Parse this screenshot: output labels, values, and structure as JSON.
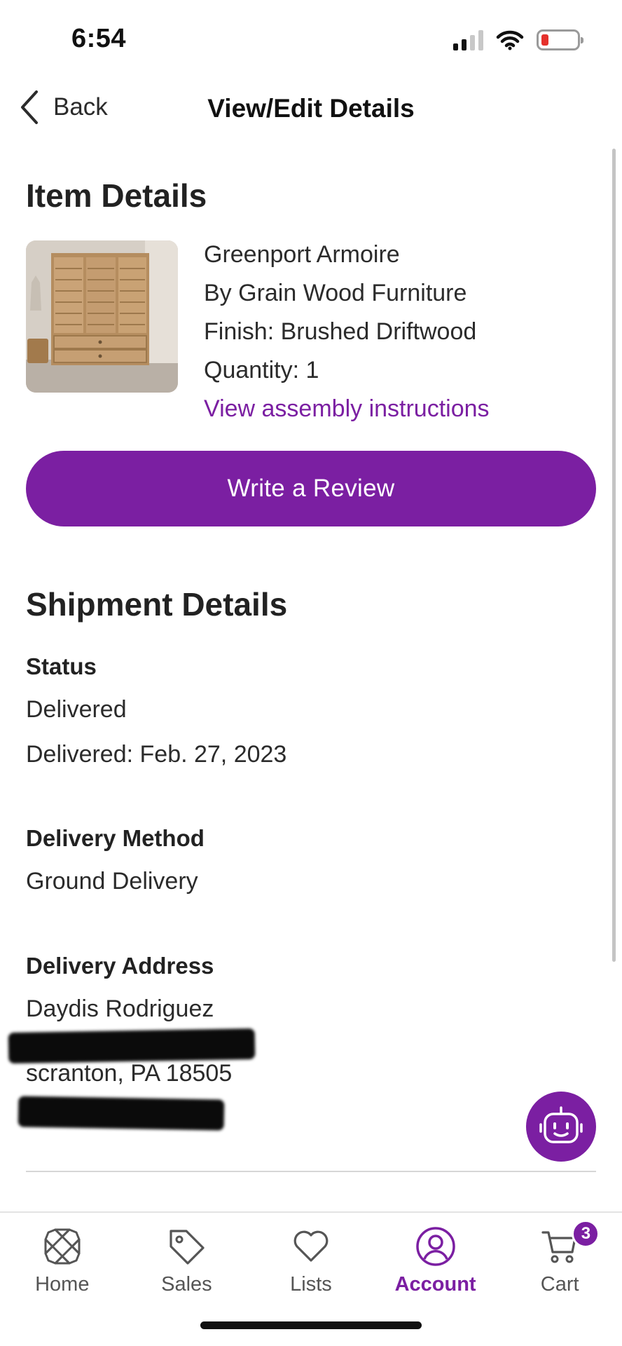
{
  "status_bar": {
    "time": "6:54"
  },
  "header": {
    "back_label": "Back",
    "title": "View/Edit Details"
  },
  "item_details": {
    "section_title": "Item Details",
    "product_name": "Greenport Armoire",
    "brand": "By Grain Wood Furniture",
    "finish": "Finish: Brushed Driftwood",
    "quantity": "Quantity: 1",
    "assembly_link": "View assembly instructions",
    "review_button": "Write a Review"
  },
  "shipment_details": {
    "section_title": "Shipment Details",
    "status_label": "Status",
    "status_value": "Delivered",
    "delivered_date": "Delivered: Feb. 27, 2023",
    "method_label": "Delivery Method",
    "method_value": "Ground Delivery",
    "address_label": "Delivery Address",
    "address_name": "Daydis Rodriguez",
    "address_city": "scranton, PA 18505"
  },
  "tab_bar": {
    "tabs": [
      {
        "label": "Home",
        "icon": "home-icon"
      },
      {
        "label": "Sales",
        "icon": "tag-icon"
      },
      {
        "label": "Lists",
        "icon": "heart-icon"
      },
      {
        "label": "Account",
        "icon": "account-icon",
        "active": true
      },
      {
        "label": "Cart",
        "icon": "cart-icon",
        "badge": "3"
      }
    ]
  },
  "colors": {
    "brand": "#7b1fa2",
    "text": "#2b2b2b",
    "divider": "#d6d6d6"
  }
}
